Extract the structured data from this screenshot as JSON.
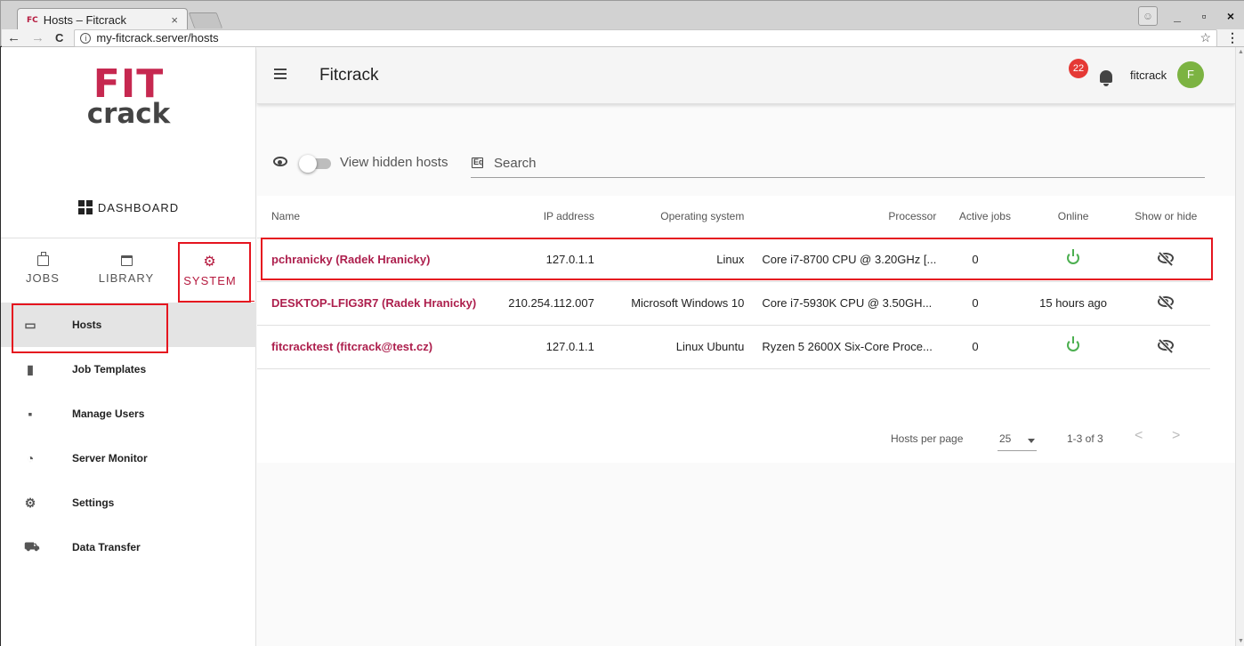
{
  "browser": {
    "tab_favicon": "FC",
    "tab_title": "Hosts – Fitcrack",
    "tab_close": "×",
    "url": "my-fitcrack.server/hosts",
    "back": "←",
    "forward": "→",
    "reload": "C",
    "info": "i",
    "star": "☆",
    "menu": "⋮",
    "minimize": "_",
    "maximize": "▫",
    "close": "×"
  },
  "sidebar": {
    "logo_top": "FIT",
    "logo_bottom": "crack",
    "dashboard": "DASHBOARD",
    "tabs": [
      {
        "label": "JOBS"
      },
      {
        "label": "LIBRARY"
      },
      {
        "label": "SYSTEM",
        "active": true
      }
    ],
    "items": [
      {
        "label": "Hosts",
        "icon": "laptop-icon",
        "active": true
      },
      {
        "label": "Job Templates",
        "icon": "file-icon"
      },
      {
        "label": "Manage Users",
        "icon": "account-box-icon"
      },
      {
        "label": "Server Monitor",
        "icon": "gauge-icon"
      },
      {
        "label": "Settings",
        "icon": "settings-gears-icon"
      },
      {
        "label": "Data Transfer",
        "icon": "dolly-icon"
      }
    ]
  },
  "appbar": {
    "title": "Fitcrack",
    "notifications": "22",
    "user": "fitcrack",
    "avatar_letter": "F"
  },
  "filters": {
    "view_hidden_label": "View hidden hosts",
    "search_placeholder": "Search"
  },
  "table": {
    "headers": {
      "name": "Name",
      "ip": "IP address",
      "os": "Operating system",
      "processor": "Processor",
      "active_jobs": "Active jobs",
      "online": "Online",
      "show_hide": "Show or hide"
    },
    "rows": [
      {
        "name": "pchranicky (Radek Hranicky)",
        "ip": "127.0.1.1",
        "os": "Linux",
        "processor": "Core i7-8700 CPU @ 3.20GHz [...",
        "active_jobs": "0",
        "online": "",
        "online_status": "online"
      },
      {
        "name": "DESKTOP-LFIG3R7 (Radek Hranicky)",
        "ip": "210.254.112.007",
        "os": "Microsoft Windows 10",
        "processor": "Core i7-5930K CPU @ 3.50GH...",
        "active_jobs": "0",
        "online": "15 hours ago",
        "online_status": "offline"
      },
      {
        "name": "fitcracktest (fitcrack@test.cz)",
        "ip": "127.0.1.1",
        "os": "Linux Ubuntu",
        "processor": "Ryzen 5 2600X Six-Core Proce...",
        "active_jobs": "0",
        "online": "",
        "online_status": "online"
      }
    ]
  },
  "pagination": {
    "per_page_label": "Hosts per page",
    "per_page_value": "25",
    "range": "1-3 of 3",
    "prev": "<",
    "next": ">"
  },
  "colors": {
    "brand": "#c62850",
    "link": "#ad1f4d",
    "online": "#4caf50",
    "badge": "#e53935",
    "avatar": "#7cb342",
    "annotation": "#e5151f"
  }
}
